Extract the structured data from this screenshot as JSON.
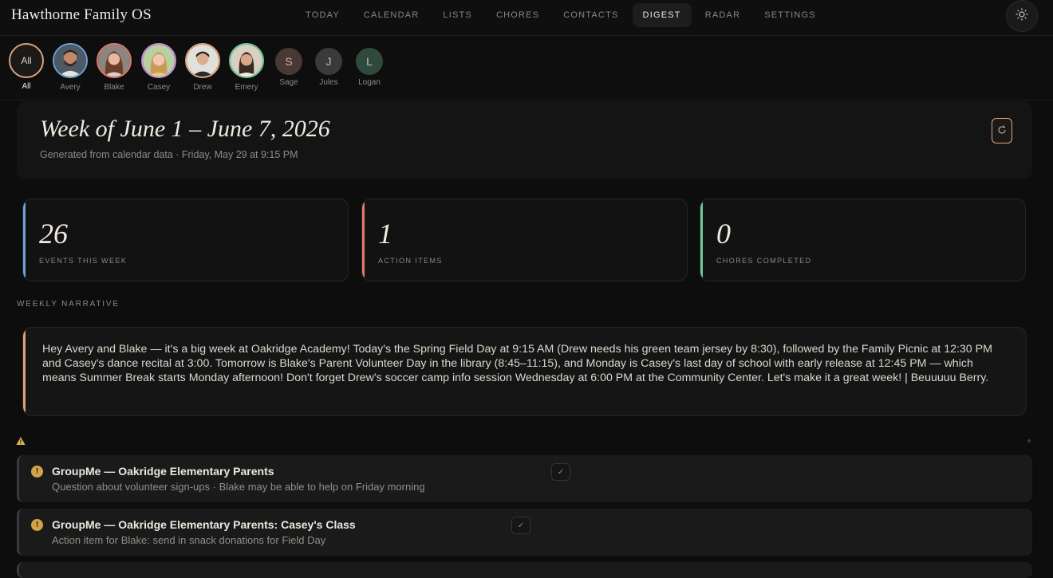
{
  "app": {
    "title": "Hawthorne Family OS"
  },
  "nav": {
    "items": [
      {
        "label": "TODAY"
      },
      {
        "label": "CALENDAR"
      },
      {
        "label": "LISTS"
      },
      {
        "label": "CHORES"
      },
      {
        "label": "CONTACTS"
      },
      {
        "label": "DIGEST",
        "active": true
      },
      {
        "label": "RADAR"
      },
      {
        "label": "SETTINGS"
      }
    ]
  },
  "members": [
    {
      "name": "All",
      "initial": "All",
      "active": true
    },
    {
      "name": "Avery"
    },
    {
      "name": "Blake"
    },
    {
      "name": "Casey"
    },
    {
      "name": "Drew"
    },
    {
      "name": "Emery"
    },
    {
      "name": "Sage",
      "initial": "S"
    },
    {
      "name": "Jules",
      "initial": "J"
    },
    {
      "name": "Logan",
      "initial": "L"
    }
  ],
  "digest": {
    "title": "Week of June 1 – June 7, 2026",
    "subtitle": "Generated from calendar data · Friday, May 29 at 9:15 PM"
  },
  "stats": [
    {
      "value": "26",
      "label": "EVENTS THIS WEEK",
      "color": "#6fa3d8"
    },
    {
      "value": "1",
      "label": "ACTION ITEMS",
      "color": "#e07a6e"
    },
    {
      "value": "0",
      "label": "CHORES COMPLETED",
      "color": "#6ec99a"
    }
  ],
  "narrative": {
    "section_label": "WEEKLY NARRATIVE",
    "text": "Hey Avery and Blake — it's a big week at Oakridge Academy! Today's the Spring Field Day at 9:15 AM (Drew needs his green team jersey by 8:30), followed by the Family Picnic at 12:30 PM and Casey's dance recital at 3:00. Tomorrow is Blake's Parent Volunteer Day in the library (8:45–11:15), and Monday is Casey's last day of school with early release at 12:45 PM — which means Summer Break starts Monday afternoon! Don't forget Drew's soccer camp info session Wednesday at 6:00 PM at the Community Center. Let's make it a great week! | Beuuuuu Berry."
  },
  "actions": [
    {
      "title": "GroupMe — Oakridge Elementary Parents",
      "desc": "Question about volunteer sign-ups · Blake may be able to help on Friday morning"
    },
    {
      "title": "GroupMe — Oakridge Elementary Parents: Casey's Class",
      "desc": "Action item for Blake: send in snack donations for Field Day"
    }
  ],
  "colors": {
    "accent": "#d9a27b",
    "warning": "#d4a347"
  }
}
